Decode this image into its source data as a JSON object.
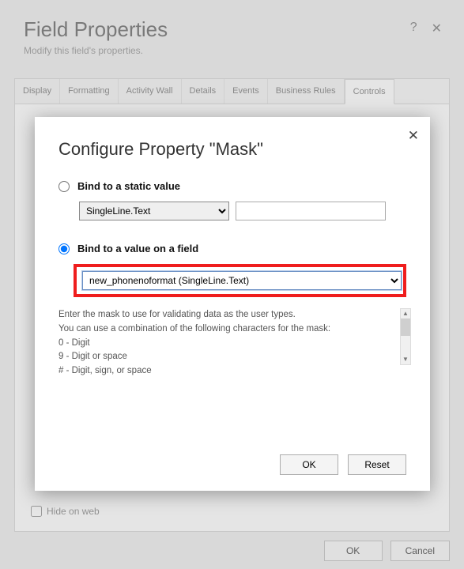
{
  "page": {
    "title": "Field Properties",
    "subtitle": "Modify this field's properties."
  },
  "tabs": {
    "items": [
      "Display",
      "Formatting",
      "Activity Wall",
      "Details",
      "Events",
      "Business Rules",
      "Controls"
    ],
    "active_index": 6
  },
  "hide_on_web": {
    "label": "Hide on web",
    "checked": false
  },
  "footer": {
    "ok": "OK",
    "cancel": "Cancel"
  },
  "modal": {
    "title": "Configure Property \"Mask\"",
    "option_static": {
      "label": "Bind to a static value",
      "checked": false,
      "type_select": "SingleLine.Text",
      "value": ""
    },
    "option_field": {
      "label": "Bind to a value on a field",
      "checked": true,
      "field_select": "new_phonenoformat (SingleLine.Text)"
    },
    "description": {
      "line1": "Enter the mask to use for validating data as the user types.",
      "line2": "You can use a combination of the following characters for the mask:",
      "line3": "0 - Digit",
      "line4": "9 - Digit or space",
      "line5": "# - Digit, sign, or space"
    },
    "buttons": {
      "ok": "OK",
      "reset": "Reset"
    }
  }
}
